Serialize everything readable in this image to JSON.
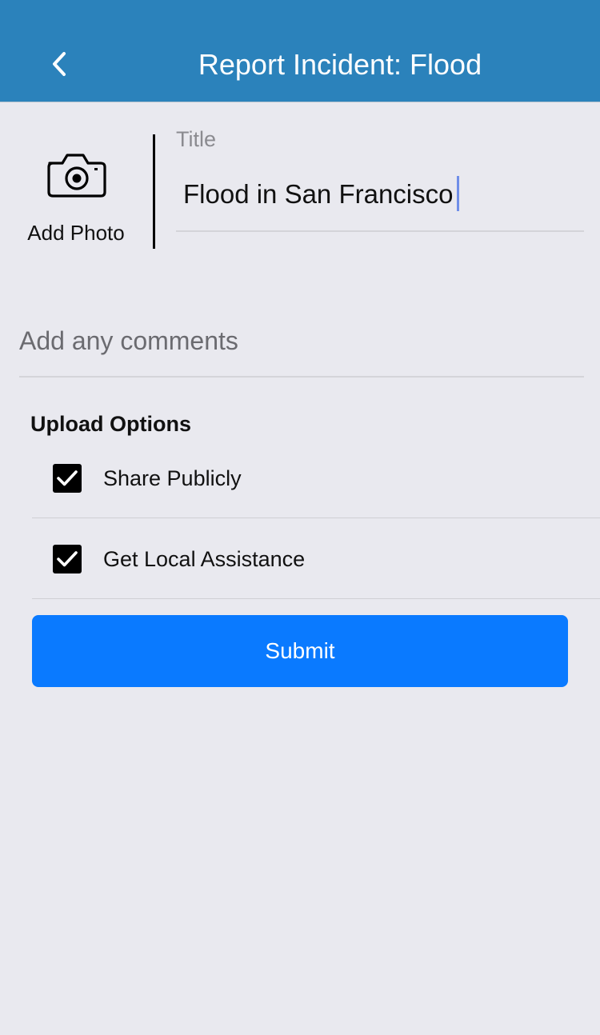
{
  "header": {
    "title": "Report Incident: Flood",
    "back_icon": "chevron-left-icon",
    "background_color": "#2b82bb"
  },
  "photo": {
    "icon": "camera-icon",
    "label": "Add Photo"
  },
  "title_field": {
    "label": "Title",
    "value": "Flood in San Francisco"
  },
  "comments_field": {
    "placeholder": "Add any comments",
    "value": ""
  },
  "upload_options": {
    "heading": "Upload Options",
    "items": [
      {
        "label": "Share Publicly",
        "checked": true
      },
      {
        "label": "Get Local Assistance",
        "checked": true
      }
    ]
  },
  "submit": {
    "label": "Submit",
    "color": "#0a7aff"
  }
}
